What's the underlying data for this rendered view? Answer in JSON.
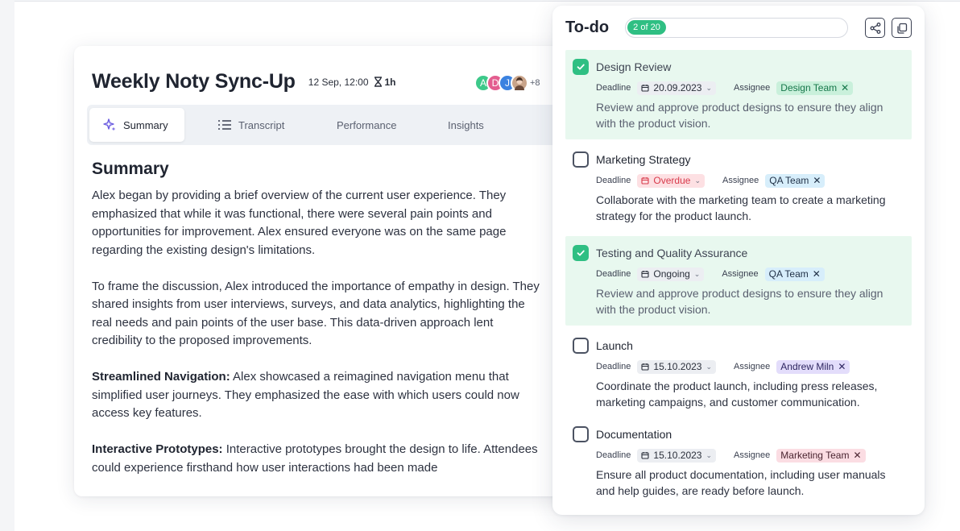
{
  "meeting": {
    "title": "Weekly Noty Sync-Up",
    "date": "12 Sep, 12:00",
    "duration": "1h",
    "avatars": [
      {
        "initial": "A",
        "color": "#3dc98a"
      },
      {
        "initial": "D",
        "color": "#e35d8f"
      },
      {
        "initial": "J",
        "color": "#3b82e0"
      },
      {
        "initial": "",
        "color": "#c9a48a"
      }
    ],
    "more_count": "+8",
    "tabs": [
      {
        "label": "Summary",
        "icon": "sparkles-icon"
      },
      {
        "label": "Transcript",
        "icon": "list-icon"
      },
      {
        "label": "Performance"
      },
      {
        "label": "Insights"
      }
    ],
    "summary_heading": "Summary",
    "paragraphs": [
      {
        "bold": "",
        "text": "Alex began by providing a brief overview of the current user experience. They emphasized that while it was functional, there were several pain points and opportunities for improvement. Alex ensured everyone was on the same page regarding the existing design's limitations."
      },
      {
        "bold": "",
        "text": "To frame the discussion, Alex introduced the importance of empathy in design. They shared insights from user interviews, surveys, and data analytics, highlighting the real needs and pain points of the user base. This data-driven approach lent credibility to the proposed improvements."
      },
      {
        "bold": "Streamlined Navigation:",
        "text": " Alex showcased a reimagined navigation menu that simplified user journeys. They emphasized the ease with which users could now access key features."
      },
      {
        "bold": "Interactive Prototypes:",
        "text": " Interactive prototypes brought the design to life. Attendees could experience firsthand how user interactions had been made"
      }
    ]
  },
  "todo": {
    "title": "To-do",
    "progress_label": "2 of 20",
    "progress_fraction": 0.1,
    "colors": {
      "accent": "#2fbf83"
    },
    "deadline_label": "Deadline",
    "assignee_label": "Assignee",
    "tasks": [
      {
        "title": "Design Review",
        "checked": true,
        "deadline": "20.09.2023",
        "deadline_style": "grey",
        "assignee": "Design Team",
        "assignee_style": "green",
        "desc": "Review and approve product designs to ensure they align with the product vision."
      },
      {
        "title": "Marketing Strategy",
        "checked": false,
        "deadline": "Overdue",
        "deadline_style": "red",
        "assignee": "QA Team",
        "assignee_style": "blue",
        "desc": "Collaborate with the marketing team to create a marketing strategy for the product launch."
      },
      {
        "title": "Testing and Quality Assurance",
        "checked": true,
        "deadline": "Ongoing",
        "deadline_style": "grey",
        "assignee": "QA Team",
        "assignee_style": "blue",
        "desc": "Review and approve product designs to ensure they align with the product vision."
      },
      {
        "title": "Launch",
        "checked": false,
        "deadline": "15.10.2023",
        "deadline_style": "grey",
        "assignee": "Andrew Miln",
        "assignee_style": "purple",
        "desc": "Coordinate the product launch, including press releases, marketing campaigns, and customer communication."
      },
      {
        "title": "Documentation",
        "checked": false,
        "deadline": "15.10.2023",
        "deadline_style": "grey",
        "assignee": "Marketing Team",
        "assignee_style": "pink",
        "desc": "Ensure all product documentation, including user manuals and help guides, are ready before launch."
      }
    ]
  }
}
